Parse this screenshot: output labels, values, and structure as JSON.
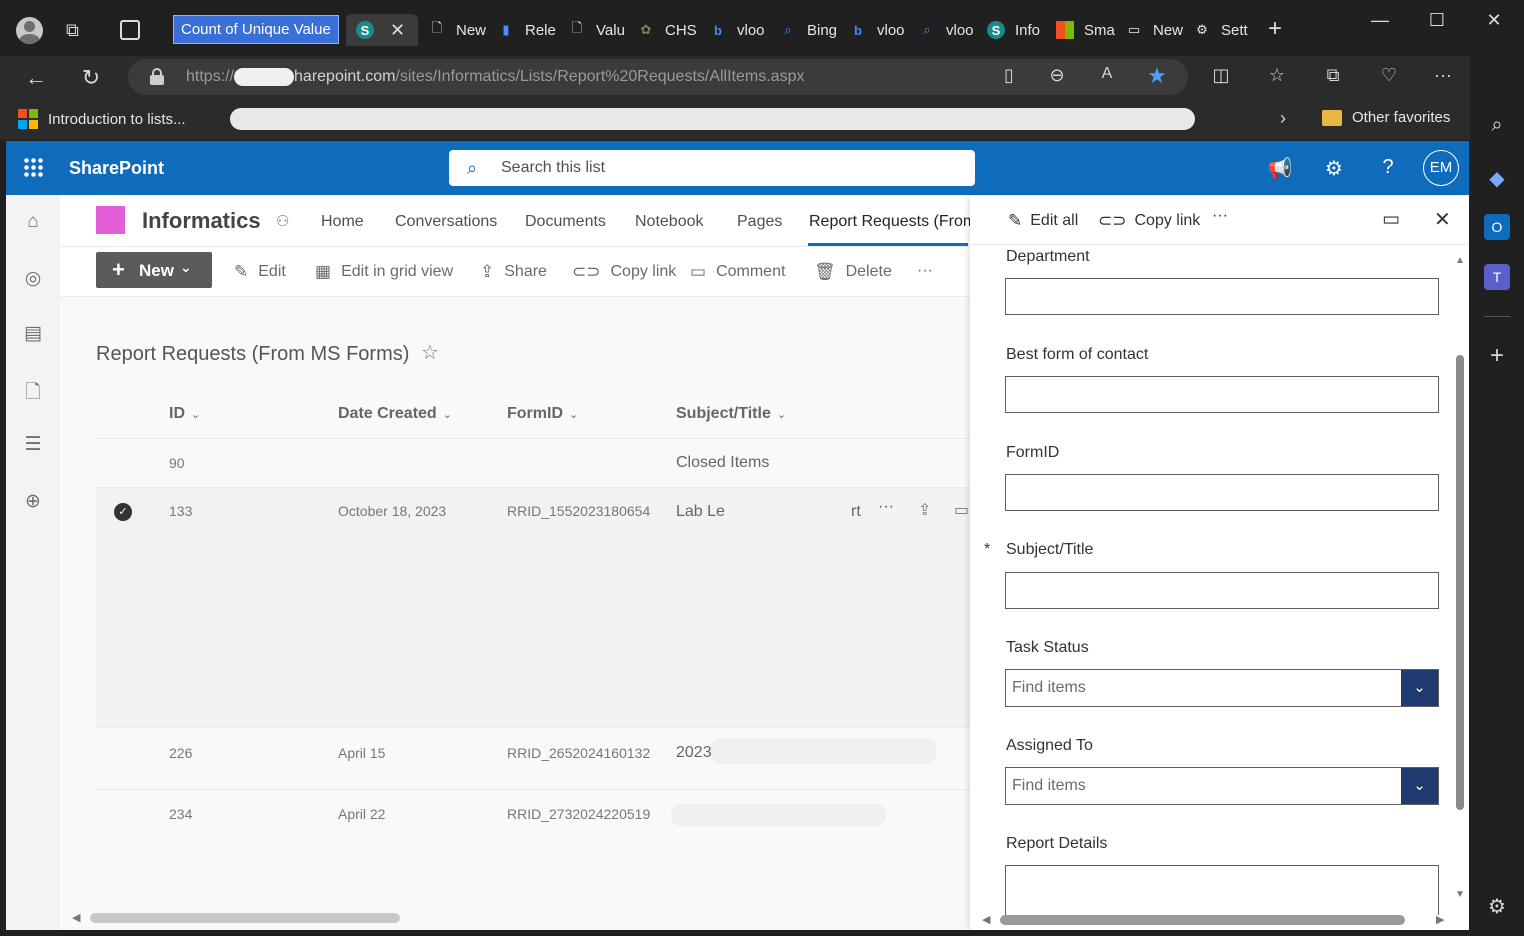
{
  "browser": {
    "tabs": [
      {
        "label": "Count of Unique Value",
        "highlighted": true
      },
      {
        "label": "",
        "icon": "sharepoint-icon",
        "active": true
      },
      {
        "label": "New"
      },
      {
        "label": "Rele"
      },
      {
        "label": "Valu"
      },
      {
        "label": "CHS"
      },
      {
        "label": "vloo"
      },
      {
        "label": "Bing"
      },
      {
        "label": "vloo"
      },
      {
        "label": "vloo"
      },
      {
        "label": "Info"
      },
      {
        "label": "Sma"
      },
      {
        "label": "New"
      },
      {
        "label": "Sett"
      }
    ],
    "url_prefix": "https://",
    "url_host": "harepoint.com",
    "url_path": "/sites/Informatics/Lists/Report%20Requests/AllItems.aspx",
    "favorites": {
      "first": "Introduction to lists...",
      "other": "Other favorites"
    }
  },
  "header": {
    "brand": "SharePoint",
    "search_placeholder": "Search this list",
    "avatar_initials": "EM",
    "accent": "#0f6cbd"
  },
  "site": {
    "name": "Informatics",
    "nav": [
      "Home",
      "Conversations",
      "Documents",
      "Notebook",
      "Pages",
      "Report Requests (From"
    ]
  },
  "commands": {
    "new": "New",
    "edit": "Edit",
    "grid": "Edit in grid view",
    "share": "Share",
    "copy_link": "Copy link",
    "comment": "Comment",
    "delete": "Delete",
    "more": "···"
  },
  "list": {
    "title": "Report Requests (From MS Forms)",
    "columns": [
      "ID",
      "Date Created",
      "FormID",
      "Subject/Title"
    ],
    "rows": [
      {
        "id": "90",
        "date": "",
        "formid": "",
        "subject": "Closed Items"
      },
      {
        "id": "133",
        "date": "October 18, 2023",
        "formid": "RRID_1552023180654",
        "subject": "Lab Le",
        "subject_tail": "rt",
        "selected": true
      },
      {
        "id": "226",
        "date": "April 15",
        "formid": "RRID_2652024160132",
        "subject": "2023"
      },
      {
        "id": "234",
        "date": "April 22",
        "formid": "RRID_2732024220519",
        "subject": ""
      }
    ]
  },
  "panel": {
    "edit_all": "Edit all",
    "copy_link": "Copy link",
    "more": "···",
    "fields": [
      {
        "label": "Department",
        "type": "text",
        "value": "",
        "required": false
      },
      {
        "label": "Best form of contact",
        "type": "text",
        "value": "",
        "required": false
      },
      {
        "label": "FormID",
        "type": "text",
        "value": "",
        "required": false
      },
      {
        "label": "Subject/Title",
        "type": "text",
        "value": "",
        "required": true
      },
      {
        "label": "Task Status",
        "type": "combo",
        "placeholder": "Find items"
      },
      {
        "label": "Assigned To",
        "type": "combo",
        "placeholder": "Find items"
      },
      {
        "label": "Report Details",
        "type": "textarea",
        "value": ""
      }
    ],
    "required_mark": "*"
  }
}
